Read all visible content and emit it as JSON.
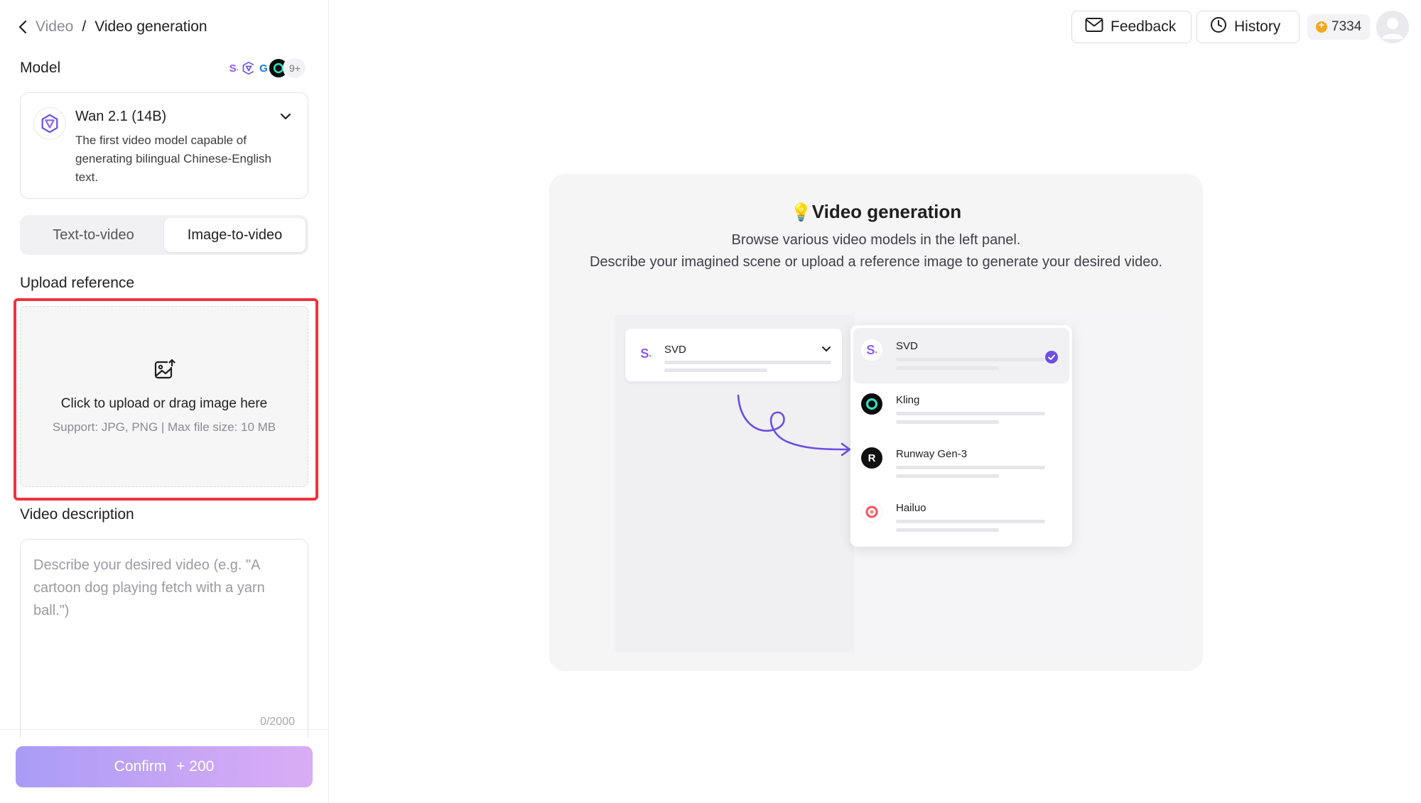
{
  "breadcrumb": {
    "parent": "Video",
    "separator": "/",
    "current": "Video generation"
  },
  "model_section": {
    "label": "Model",
    "more_badge": "9+",
    "selected": {
      "name": "Wan 2.1 (14B)",
      "description": "The first video model capable of generating bilingual Chinese-English text."
    }
  },
  "mode_tabs": [
    {
      "label": "Text-to-video",
      "active": false
    },
    {
      "label": "Image-to-video",
      "active": true
    }
  ],
  "upload": {
    "label": "Upload reference",
    "title": "Click to upload or drag image here",
    "subtitle": "Support: JPG, PNG | Max file size: 10 MB"
  },
  "description": {
    "label": "Video description",
    "placeholder": "Describe your desired video (e.g. \"A cartoon dog playing fetch with a yarn ball.\")",
    "counter": "0/2000"
  },
  "confirm": {
    "label": "Confirm",
    "cost": "+ 200"
  },
  "topbar": {
    "feedback_label": "Feedback",
    "history_label": "History",
    "credits": "7334"
  },
  "hero": {
    "title": "Video generation",
    "line1": "Browse various video models in the left panel.",
    "line2": "Describe your imagined scene or upload a reference image to generate your desired video.",
    "illustration": {
      "select_value": "SVD",
      "models": [
        "SVD",
        "Kling",
        "Runway Gen-3",
        "Hailuo"
      ],
      "selected_model": "SVD"
    }
  },
  "colors": {
    "accent": "#6d4fe0",
    "highlight_border": "#ef3340",
    "confirm_start": "#a99cf6",
    "confirm_end": "#d9adf5",
    "coin": "#f5a623"
  }
}
